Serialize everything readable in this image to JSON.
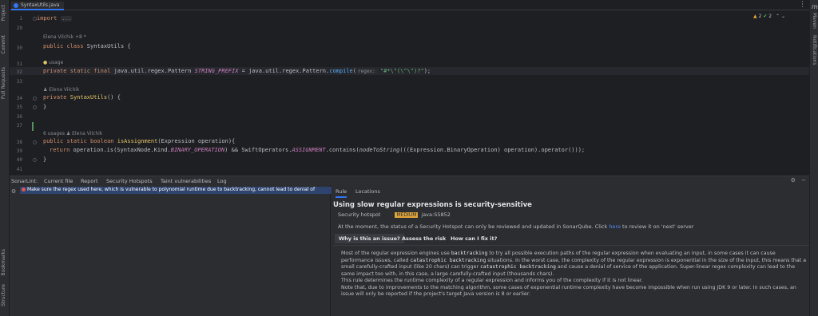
{
  "left_strip": {
    "project": "Project",
    "commit": "Commit",
    "pull_requests": "Pull Requests",
    "bookmarks": "Bookmarks",
    "structure": "Structure"
  },
  "right_strip": {
    "maven": "Maven",
    "notifications": "Notifications"
  },
  "editor": {
    "tab_label": "SyntaxUtils.java",
    "warnings": "2",
    "checks": "2",
    "lines": {
      "l1": "1",
      "l29": "29",
      "l30": "30",
      "l31": "31",
      "l32": "32",
      "l33": "33",
      "l34": "34",
      "l35": "35",
      "l36": "36",
      "l37": "37",
      "l38": "38",
      "l39": "39",
      "l40": "40",
      "l41": "41"
    },
    "import_kw": "import",
    "import_fold": "...",
    "author1": "Elena Vilchik +8 *",
    "class_kw": "public class",
    "class_name": "SyntaxUtils",
    "brace_open": " {",
    "usage_hint": "usage",
    "l32_mods": "private static final",
    "l32_type": " java.util.regex.Pattern ",
    "l32_const": "STRING_PREFIX",
    "l32_eq": " = java.util.regex.Pattern.",
    "l32_compile": "compile",
    "l32_paren": "(",
    "l32_regex_label": "regex:",
    "l32_string": "\"#*\\\"(\\\"\\\")?\"",
    "l32_end": ");",
    "author2": "Elena Vilchik",
    "l34_kw": "private",
    "l34_fn": "SyntaxUtils",
    "l34_rest": "() {",
    "close_brace": "}",
    "usages2": "6 usages",
    "author3": "Elena Vilchik",
    "l38_kw": "public static boolean",
    "l38_fn": "isAssignment",
    "l38_rest": "(Expression operation){",
    "l39_kw": "return",
    "l39_a": " operation.is(SyntaxNode.Kind.",
    "l39_const": "BINARY_OPERATION",
    "l39_b": ") && SwiftOperators.",
    "l39_const2": "ASSIGNMENT",
    "l39_c": ".contains(",
    "l39_fn": "nodeToString",
    "l39_d": "(((Expression.BinaryOperation) operation).operator()));"
  },
  "sonar": {
    "title": "SonarLint:",
    "tabs": [
      "Current file",
      "Report",
      "Security Hotspots",
      "Taint vulnerabilities",
      "Log"
    ],
    "issue": "Make sure the regex used here, which is vulnerable to polynomial runtime due to backtracking, cannot lead to denial of",
    "rule_tabs": [
      "Rule",
      "Locations"
    ],
    "rule_title": "Using slow regular expressions is security-sensitive",
    "hotspot_label": "Security hotspot",
    "severity": "MEDIUM",
    "rule_key": "java:S5852",
    "status_text_a": "At the moment, the status of a Security Hotspot can only be reviewed and updated in SonarQube. Click",
    "status_link": "here",
    "status_text_b": "to review it on 'next' server",
    "subtabs": [
      "Why is this an issue?",
      "Assess the risk",
      "How can I fix it?"
    ],
    "desc": {
      "p1_a": "Most of the regular expression engines use",
      "p1_code1": "backtracking",
      "p1_b": "to try all possible execution paths of the regular expression when evaluating an input, in some cases it can cause performance issues, called",
      "p1_code2": "catastrophic backtracking",
      "p1_c": "situations. In the worst case, the complexity of the regular expression is exponential in the size of the input, this means that a small carefully-crafted input (like 20 chars) can trigger",
      "p1_code3": "catastrophic backtracking",
      "p1_d": "and cause a denial of service of the application. Super-linear regex complexity can lead to the same impact too with, in this case, a large carefully-crafted input (thousands chars).",
      "p2": "This rule determines the runtime complexity of a regular expression and informs you of the complexity if it is not linear.",
      "p3": "Note that, due to improvements to the matching algorithm, some cases of exponential runtime complexity have become impossible when run using JDK 9 or later. In such cases, an issue will only be reported if the project's target Java version is 8 or earlier."
    }
  }
}
